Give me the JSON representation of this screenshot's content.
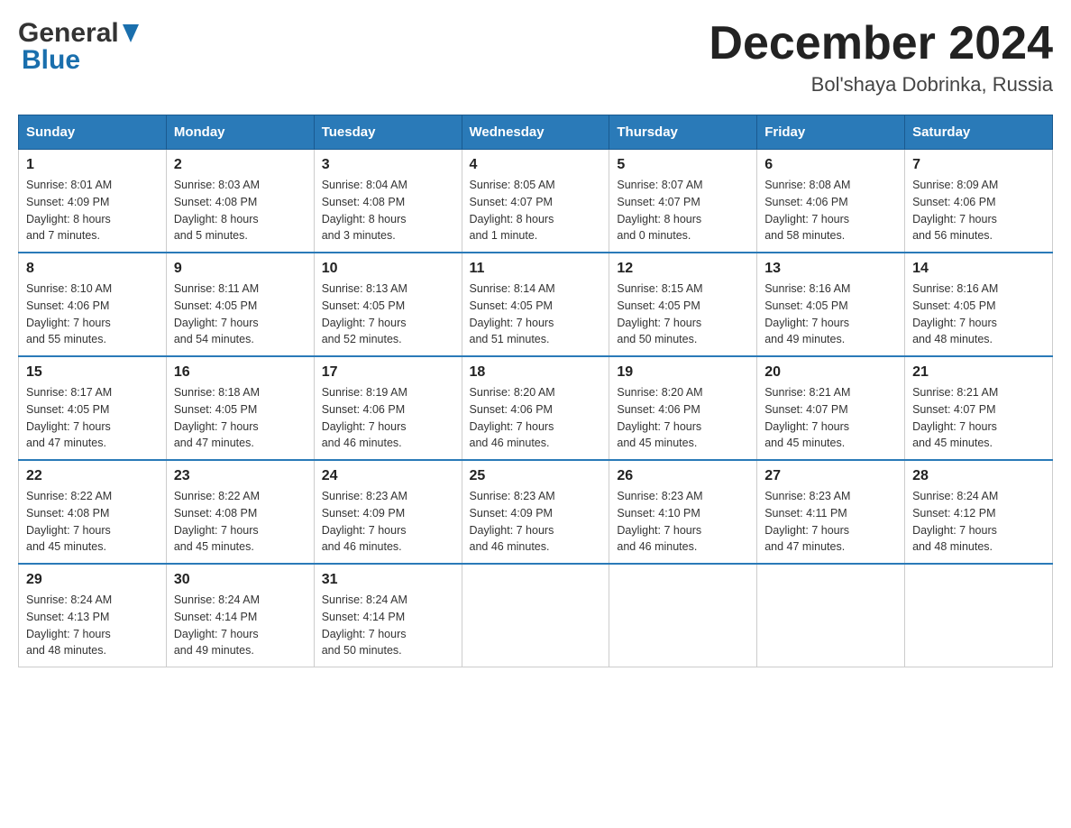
{
  "header": {
    "logo_general": "General",
    "logo_blue": "Blue",
    "month_title": "December 2024",
    "location": "Bol'shaya Dobrinka, Russia"
  },
  "days_of_week": [
    "Sunday",
    "Monday",
    "Tuesday",
    "Wednesday",
    "Thursday",
    "Friday",
    "Saturday"
  ],
  "weeks": [
    [
      {
        "day": "1",
        "sunrise": "Sunrise: 8:01 AM",
        "sunset": "Sunset: 4:09 PM",
        "daylight": "Daylight: 8 hours",
        "daylight2": "and 7 minutes."
      },
      {
        "day": "2",
        "sunrise": "Sunrise: 8:03 AM",
        "sunset": "Sunset: 4:08 PM",
        "daylight": "Daylight: 8 hours",
        "daylight2": "and 5 minutes."
      },
      {
        "day": "3",
        "sunrise": "Sunrise: 8:04 AM",
        "sunset": "Sunset: 4:08 PM",
        "daylight": "Daylight: 8 hours",
        "daylight2": "and 3 minutes."
      },
      {
        "day": "4",
        "sunrise": "Sunrise: 8:05 AM",
        "sunset": "Sunset: 4:07 PM",
        "daylight": "Daylight: 8 hours",
        "daylight2": "and 1 minute."
      },
      {
        "day": "5",
        "sunrise": "Sunrise: 8:07 AM",
        "sunset": "Sunset: 4:07 PM",
        "daylight": "Daylight: 8 hours",
        "daylight2": "and 0 minutes."
      },
      {
        "day": "6",
        "sunrise": "Sunrise: 8:08 AM",
        "sunset": "Sunset: 4:06 PM",
        "daylight": "Daylight: 7 hours",
        "daylight2": "and 58 minutes."
      },
      {
        "day": "7",
        "sunrise": "Sunrise: 8:09 AM",
        "sunset": "Sunset: 4:06 PM",
        "daylight": "Daylight: 7 hours",
        "daylight2": "and 56 minutes."
      }
    ],
    [
      {
        "day": "8",
        "sunrise": "Sunrise: 8:10 AM",
        "sunset": "Sunset: 4:06 PM",
        "daylight": "Daylight: 7 hours",
        "daylight2": "and 55 minutes."
      },
      {
        "day": "9",
        "sunrise": "Sunrise: 8:11 AM",
        "sunset": "Sunset: 4:05 PM",
        "daylight": "Daylight: 7 hours",
        "daylight2": "and 54 minutes."
      },
      {
        "day": "10",
        "sunrise": "Sunrise: 8:13 AM",
        "sunset": "Sunset: 4:05 PM",
        "daylight": "Daylight: 7 hours",
        "daylight2": "and 52 minutes."
      },
      {
        "day": "11",
        "sunrise": "Sunrise: 8:14 AM",
        "sunset": "Sunset: 4:05 PM",
        "daylight": "Daylight: 7 hours",
        "daylight2": "and 51 minutes."
      },
      {
        "day": "12",
        "sunrise": "Sunrise: 8:15 AM",
        "sunset": "Sunset: 4:05 PM",
        "daylight": "Daylight: 7 hours",
        "daylight2": "and 50 minutes."
      },
      {
        "day": "13",
        "sunrise": "Sunrise: 8:16 AM",
        "sunset": "Sunset: 4:05 PM",
        "daylight": "Daylight: 7 hours",
        "daylight2": "and 49 minutes."
      },
      {
        "day": "14",
        "sunrise": "Sunrise: 8:16 AM",
        "sunset": "Sunset: 4:05 PM",
        "daylight": "Daylight: 7 hours",
        "daylight2": "and 48 minutes."
      }
    ],
    [
      {
        "day": "15",
        "sunrise": "Sunrise: 8:17 AM",
        "sunset": "Sunset: 4:05 PM",
        "daylight": "Daylight: 7 hours",
        "daylight2": "and 47 minutes."
      },
      {
        "day": "16",
        "sunrise": "Sunrise: 8:18 AM",
        "sunset": "Sunset: 4:05 PM",
        "daylight": "Daylight: 7 hours",
        "daylight2": "and 47 minutes."
      },
      {
        "day": "17",
        "sunrise": "Sunrise: 8:19 AM",
        "sunset": "Sunset: 4:06 PM",
        "daylight": "Daylight: 7 hours",
        "daylight2": "and 46 minutes."
      },
      {
        "day": "18",
        "sunrise": "Sunrise: 8:20 AM",
        "sunset": "Sunset: 4:06 PM",
        "daylight": "Daylight: 7 hours",
        "daylight2": "and 46 minutes."
      },
      {
        "day": "19",
        "sunrise": "Sunrise: 8:20 AM",
        "sunset": "Sunset: 4:06 PM",
        "daylight": "Daylight: 7 hours",
        "daylight2": "and 45 minutes."
      },
      {
        "day": "20",
        "sunrise": "Sunrise: 8:21 AM",
        "sunset": "Sunset: 4:07 PM",
        "daylight": "Daylight: 7 hours",
        "daylight2": "and 45 minutes."
      },
      {
        "day": "21",
        "sunrise": "Sunrise: 8:21 AM",
        "sunset": "Sunset: 4:07 PM",
        "daylight": "Daylight: 7 hours",
        "daylight2": "and 45 minutes."
      }
    ],
    [
      {
        "day": "22",
        "sunrise": "Sunrise: 8:22 AM",
        "sunset": "Sunset: 4:08 PM",
        "daylight": "Daylight: 7 hours",
        "daylight2": "and 45 minutes."
      },
      {
        "day": "23",
        "sunrise": "Sunrise: 8:22 AM",
        "sunset": "Sunset: 4:08 PM",
        "daylight": "Daylight: 7 hours",
        "daylight2": "and 45 minutes."
      },
      {
        "day": "24",
        "sunrise": "Sunrise: 8:23 AM",
        "sunset": "Sunset: 4:09 PM",
        "daylight": "Daylight: 7 hours",
        "daylight2": "and 46 minutes."
      },
      {
        "day": "25",
        "sunrise": "Sunrise: 8:23 AM",
        "sunset": "Sunset: 4:09 PM",
        "daylight": "Daylight: 7 hours",
        "daylight2": "and 46 minutes."
      },
      {
        "day": "26",
        "sunrise": "Sunrise: 8:23 AM",
        "sunset": "Sunset: 4:10 PM",
        "daylight": "Daylight: 7 hours",
        "daylight2": "and 46 minutes."
      },
      {
        "day": "27",
        "sunrise": "Sunrise: 8:23 AM",
        "sunset": "Sunset: 4:11 PM",
        "daylight": "Daylight: 7 hours",
        "daylight2": "and 47 minutes."
      },
      {
        "day": "28",
        "sunrise": "Sunrise: 8:24 AM",
        "sunset": "Sunset: 4:12 PM",
        "daylight": "Daylight: 7 hours",
        "daylight2": "and 48 minutes."
      }
    ],
    [
      {
        "day": "29",
        "sunrise": "Sunrise: 8:24 AM",
        "sunset": "Sunset: 4:13 PM",
        "daylight": "Daylight: 7 hours",
        "daylight2": "and 48 minutes."
      },
      {
        "day": "30",
        "sunrise": "Sunrise: 8:24 AM",
        "sunset": "Sunset: 4:14 PM",
        "daylight": "Daylight: 7 hours",
        "daylight2": "and 49 minutes."
      },
      {
        "day": "31",
        "sunrise": "Sunrise: 8:24 AM",
        "sunset": "Sunset: 4:14 PM",
        "daylight": "Daylight: 7 hours",
        "daylight2": "and 50 minutes."
      },
      null,
      null,
      null,
      null
    ]
  ]
}
